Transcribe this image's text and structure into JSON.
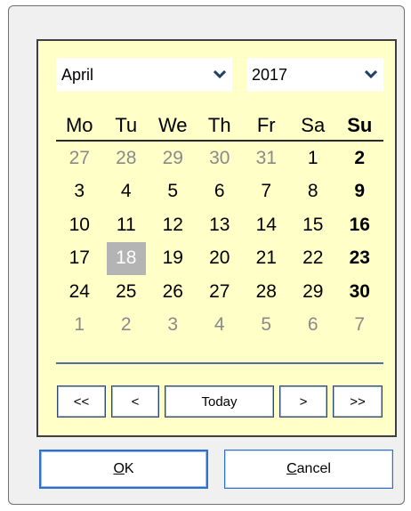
{
  "month_select": {
    "value": "April",
    "icon": "chevron-down-icon"
  },
  "year_select": {
    "value": "2017",
    "icon": "chevron-down-icon"
  },
  "weekdays": [
    "Mo",
    "Tu",
    "We",
    "Th",
    "Fr",
    "Sa",
    "Su"
  ],
  "weeks": [
    [
      "27",
      "28",
      "29",
      "30",
      "31",
      "1",
      "2"
    ],
    [
      "3",
      "4",
      "5",
      "6",
      "7",
      "8",
      "9"
    ],
    [
      "10",
      "11",
      "12",
      "13",
      "14",
      "15",
      "16"
    ],
    [
      "17",
      "18",
      "19",
      "20",
      "21",
      "22",
      "23"
    ],
    [
      "24",
      "25",
      "26",
      "27",
      "28",
      "29",
      "30"
    ],
    [
      "1",
      "2",
      "3",
      "4",
      "5",
      "6",
      "7"
    ]
  ],
  "selected_date": "18",
  "nav": {
    "first": "<<",
    "prev": "<",
    "today": "Today",
    "next": ">",
    "last": ">>"
  },
  "buttons": {
    "ok_mnemonic": "O",
    "ok_rest": "K",
    "cancel_mnemonic": "C",
    "cancel_rest": "ancel"
  },
  "colors": {
    "calendar_bg": "#ffffc8",
    "selected_bg": "#b4b4b4",
    "other_month_text": "#8a8a8a",
    "focus_border": "#2f6fd0"
  }
}
